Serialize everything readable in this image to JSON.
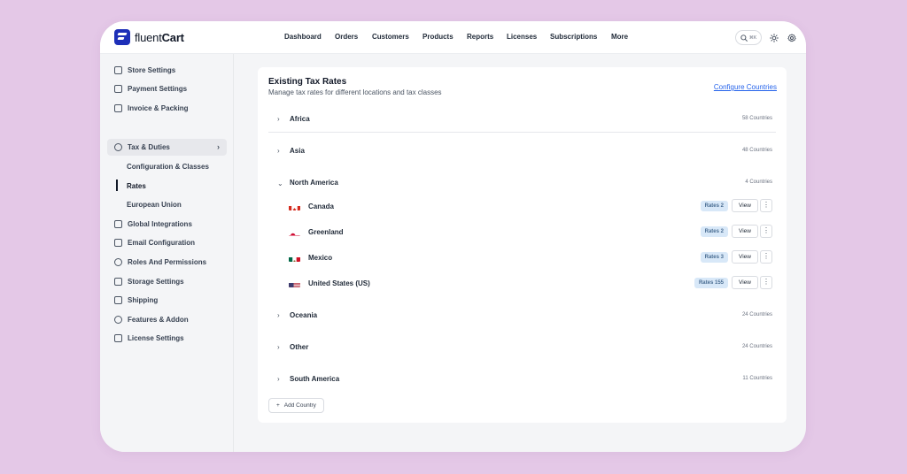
{
  "app": {
    "brand_light": "fluent",
    "brand_bold": "Cart"
  },
  "nav": [
    "Dashboard",
    "Orders",
    "Customers",
    "Products",
    "Reports",
    "Licenses",
    "Subscriptions",
    "More"
  ],
  "tools": {
    "search_kbd": "⌘K"
  },
  "sidebar": {
    "items": [
      {
        "label": "Store Settings",
        "icon": "store-icon"
      },
      {
        "label": "Payment Settings",
        "icon": "payment-icon"
      },
      {
        "label": "Invoice & Packing",
        "icon": "invoice-icon"
      },
      {
        "label": "Tax & Duties",
        "icon": "tax-icon"
      },
      {
        "label": "Global Integrations",
        "icon": "integrations-icon"
      },
      {
        "label": "Email Configuration",
        "icon": "email-icon"
      },
      {
        "label": "Roles And Permissions",
        "icon": "shield-icon"
      },
      {
        "label": "Storage Settings",
        "icon": "storage-icon"
      },
      {
        "label": "Shipping",
        "icon": "shipping-icon"
      },
      {
        "label": "Features & Addon",
        "icon": "puzzle-icon"
      },
      {
        "label": "License Settings",
        "icon": "license-icon"
      }
    ],
    "sub_items": [
      "Configuration & Classes",
      "Rates",
      "European Union"
    ]
  },
  "main": {
    "title": "Existing Tax Rates",
    "subtitle": "Manage tax rates for different locations and tax classes",
    "configure_link": "Configure Countries",
    "regions": [
      {
        "name": "Africa",
        "count": "58 Countries"
      },
      {
        "name": "Asia",
        "count": "48 Countries"
      },
      {
        "name": "North America",
        "count": "4 Countries"
      },
      {
        "name": "Oceania",
        "count": "24 Countries"
      },
      {
        "name": "Other",
        "count": "24 Countries"
      },
      {
        "name": "South America",
        "count": "11 Countries"
      }
    ],
    "countries": [
      {
        "name": "Canada",
        "rates": "Rates 2",
        "view": "View"
      },
      {
        "name": "Greenland",
        "rates": "Rates 2",
        "view": "View"
      },
      {
        "name": "Mexico",
        "rates": "Rates 3",
        "view": "View"
      },
      {
        "name": "United States (US)",
        "rates": "Rates 155",
        "view": "View"
      }
    ],
    "add_button": "Add Country"
  },
  "colors": {
    "accent": "#1d2fb8",
    "link": "#2563eb",
    "rate_badge": "#d8e8f8",
    "background": "#e4c8e7"
  }
}
